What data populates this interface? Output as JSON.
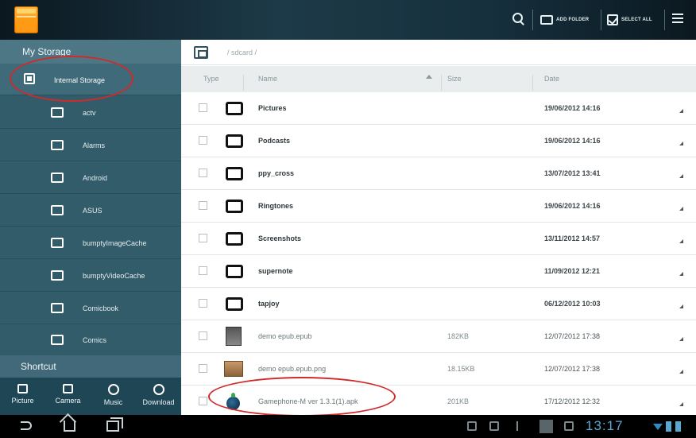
{
  "toolbar": {
    "add_folder_label": "ADD FOLDER",
    "select_all_label": "SELECT ALL"
  },
  "sidebar": {
    "header": "My Storage",
    "root": "Internal Storage",
    "folders": [
      "actv",
      "Alarms",
      "Android",
      "ASUS",
      "bumptyImageCache",
      "bumptyVideoCache",
      "Comicbook",
      "Comics"
    ],
    "shortcut_header": "Shortcut",
    "shortcuts": [
      {
        "label": "Picture",
        "icon": "picture-icon"
      },
      {
        "label": "Camera",
        "icon": "camera-icon"
      },
      {
        "label": "Music",
        "icon": "music-icon"
      },
      {
        "label": "Download",
        "icon": "download-icon"
      }
    ]
  },
  "path": "/ sdcard /",
  "columns": {
    "type": "Type",
    "name": "Name",
    "size": "Size",
    "date": "Date"
  },
  "files": [
    {
      "name": "Pictures",
      "size": "",
      "date": "19/06/2012 14:16",
      "kind": "folder"
    },
    {
      "name": "Podcasts",
      "size": "",
      "date": "19/06/2012 14:16",
      "kind": "folder"
    },
    {
      "name": "ppy_cross",
      "size": "",
      "date": "13/07/2012 13:41",
      "kind": "folder"
    },
    {
      "name": "Ringtones",
      "size": "",
      "date": "19/06/2012 14:16",
      "kind": "folder"
    },
    {
      "name": "Screenshots",
      "size": "",
      "date": "13/11/2012 14:57",
      "kind": "folder"
    },
    {
      "name": "supernote",
      "size": "",
      "date": "11/09/2012 12:21",
      "kind": "folder"
    },
    {
      "name": "tapjoy",
      "size": "",
      "date": "06/12/2012 10:03",
      "kind": "folder"
    },
    {
      "name": "demo epub.epub",
      "size": "182KB",
      "date": "12/07/2012 17:38",
      "kind": "file-dark"
    },
    {
      "name": "demo epub.epub.png",
      "size": "18.15KB",
      "date": "12/07/2012 17:38",
      "kind": "file-tan"
    },
    {
      "name": "Gamephone-M ver 1.3.1(1).apk",
      "size": "201KB",
      "date": "17/12/2012 12:32",
      "kind": "file-apk"
    }
  ],
  "status": {
    "clock": "13:17"
  },
  "colors": {
    "sidebar": "#325c6a",
    "accent": "#5aa7d0",
    "annotation": "#cf2b2b"
  }
}
